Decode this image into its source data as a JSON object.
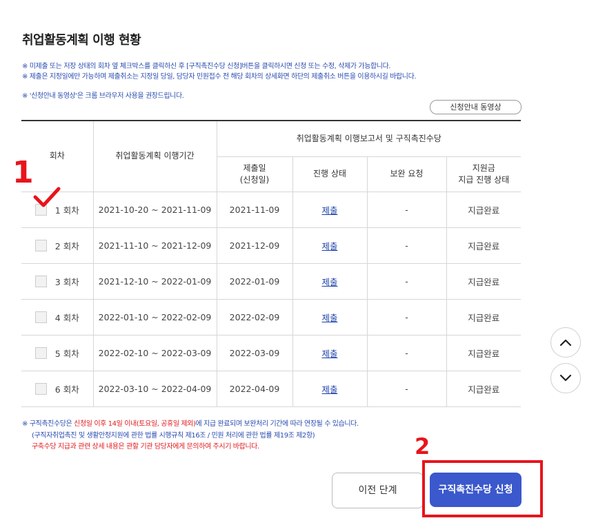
{
  "page": {
    "title": "취업활동계획 이행 현황",
    "notices": [
      "※ 미제출 또는 저장 상태의 회차 옆 체크박스를 클릭하신 후 [구직촉진수당 신청]버튼을 클릭하시면 신청 또는 수정, 삭제가 가능합니다.",
      "※ 제출은 지정일에만 가능하며 제출취소는 지정일 당일, 담당자 민원접수 전 해당 회차의 상세화면 하단의 제출취소 버튼을 이용하시길 바랍니다.",
      "※ '신청안내 동영상'은 크롬 브라우저 사용을 권장드립니다."
    ],
    "video_button": "신청안내 동영상"
  },
  "table": {
    "headers": {
      "round": "회차",
      "period": "취업활동계획 이행기간",
      "group": "취업활동계획 이행보고서 및 구직촉진수당",
      "submit_date_1": "제출일",
      "submit_date_2": "(신청일)",
      "progress": "진행 상태",
      "supplement": "보완 요청",
      "payment_1": "지원금",
      "payment_2": "지급 진행 상태"
    },
    "rows": [
      {
        "round": "1 회차",
        "period": "2021-10-20 ~ 2021-11-09",
        "date": "2021-11-09",
        "status": "제출",
        "supplement": "-",
        "payment": "지급완료"
      },
      {
        "round": "2 회차",
        "period": "2021-11-10 ~ 2021-12-09",
        "date": "2021-12-09",
        "status": "제출",
        "supplement": "-",
        "payment": "지급완료"
      },
      {
        "round": "3 회차",
        "period": "2021-12-10 ~ 2022-01-09",
        "date": "2022-01-09",
        "status": "제출",
        "supplement": "-",
        "payment": "지급완료"
      },
      {
        "round": "4 회차",
        "period": "2022-01-10 ~ 2022-02-09",
        "date": "2022-02-09",
        "status": "제출",
        "supplement": "-",
        "payment": "지급완료"
      },
      {
        "round": "5 회차",
        "period": "2022-02-10 ~ 2022-03-09",
        "date": "2022-03-09",
        "status": "제출",
        "supplement": "-",
        "payment": "지급완료"
      },
      {
        "round": "6 회차",
        "period": "2022-03-10 ~ 2022-04-09",
        "date": "2022-04-09",
        "status": "제출",
        "supplement": "-",
        "payment": "지급완료"
      }
    ]
  },
  "footnote": {
    "line1_a": "※ 구직촉진수당은 ",
    "line1_red": "신청일 이후 14일 이내(토요일, 공휴일 제외)",
    "line1_b": "에 지급 완료되며 보완처리 기간에 따라 연장될 수 있습니다.",
    "line2": "(구직자취업촉진 및 생활안정지원에 관한 법률 시행규칙 제16조 / 민원 처리에 관한 법률 제19조 제2항)",
    "line3": "구축수당 지급과 관련 상세 내용은 관할 기관 담당자에게 문의하여 주시기 바랍니다."
  },
  "annotations": {
    "step1": "1",
    "step2": "2",
    "color": "#e8141b"
  },
  "buttons": {
    "prev": "이전 단계",
    "apply": "구직촉진수당 신청"
  },
  "icons": {
    "scroll_up": "chevron-up-icon",
    "scroll_down": "chevron-down-icon",
    "check": "check-mark-icon"
  },
  "colors": {
    "accent": "#3b58cc",
    "notice_blue": "#2a4cb0",
    "link": "#1a3fa8",
    "red": "#e0191f"
  }
}
